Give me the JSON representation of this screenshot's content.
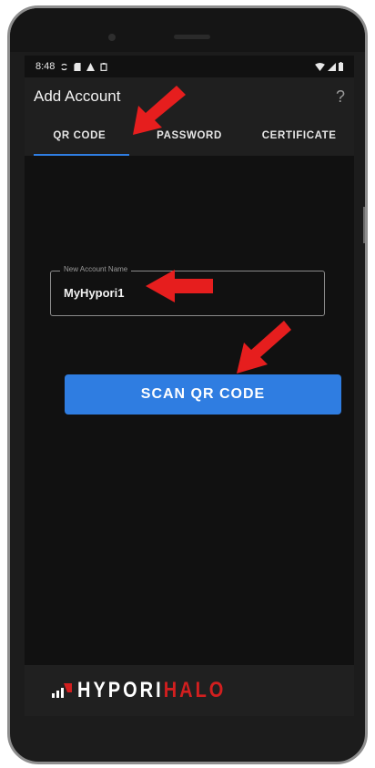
{
  "status_bar": {
    "time": "8:48",
    "icons_left": [
      "sync-icon",
      "sd-card-icon",
      "alert-icon",
      "clipboard-icon"
    ],
    "icons_right": [
      "wifi-icon",
      "signal-icon",
      "battery-icon"
    ]
  },
  "app_bar": {
    "title": "Add Account",
    "help_label": "?"
  },
  "tabs": [
    {
      "label": "QR CODE",
      "active": true
    },
    {
      "label": "PASSWORD",
      "active": false
    },
    {
      "label": "CERTIFICATE",
      "active": false
    }
  ],
  "account_field": {
    "label": "New Account Name",
    "value": "MyHypori1"
  },
  "scan_button": {
    "label": "SCAN QR CODE"
  },
  "logo": {
    "part1": "HYPORI",
    "part2": "HALO"
  },
  "colors": {
    "accent": "#2f7de1",
    "annotation_arrow": "#e61e1e",
    "background": "#111111",
    "app_bar": "#1f1f1f",
    "logo_accent": "#d21f1f"
  }
}
